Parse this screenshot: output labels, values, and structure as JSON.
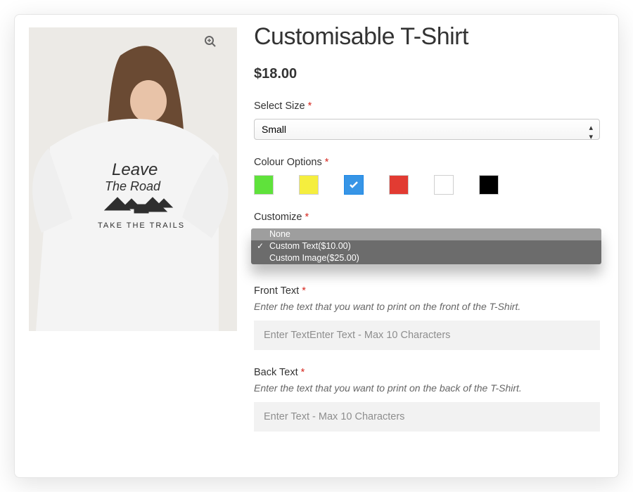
{
  "product": {
    "title": "Customisable T-Shirt",
    "price": "$18.00"
  },
  "size": {
    "label": "Select Size",
    "selected": "Small"
  },
  "colour": {
    "label": "Colour Options",
    "options": [
      "green",
      "yellow",
      "blue",
      "red",
      "white",
      "black"
    ],
    "colors": {
      "green": "#5fe23b",
      "yellow": "#f5ee3e",
      "blue": "#3795e6",
      "red": "#e23b32",
      "white": "#ffffff",
      "black": "#000000"
    },
    "selected": "blue"
  },
  "customize": {
    "label": "Customize",
    "options": [
      {
        "label": "None",
        "highlighted": true,
        "checked": false
      },
      {
        "label": "Custom Text($10.00)",
        "highlighted": false,
        "checked": true
      },
      {
        "label": "Custom Image($25.00)",
        "highlighted": false,
        "checked": false
      }
    ]
  },
  "front": {
    "label": "Front Text",
    "help": "Enter the text that you want to print on the front of the T-Shirt.",
    "placeholder": "Enter TextEnter Text - Max 10 Characters"
  },
  "back": {
    "label": "Back Text",
    "help": "Enter the text that you want to print on the back of the T-Shirt.",
    "placeholder": "Enter Text - Max 10 Characters"
  },
  "img": {
    "line1": "Leave",
    "line2": "The Road",
    "line3": "TAKE THE TRAILS"
  },
  "asterisk": "*"
}
